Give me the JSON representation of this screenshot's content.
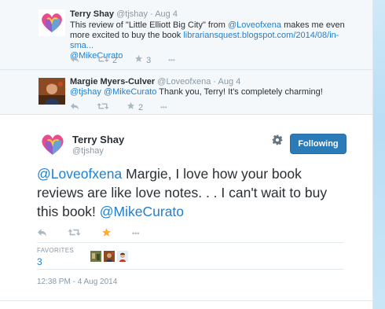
{
  "tweet1": {
    "name": "Terry Shay",
    "handle": "@tjshay",
    "time": "· Aug 4",
    "text_before": "This review of \"Little Elliott Big City\" from ",
    "mention1": "@Loveofxena",
    "text_middle": " makes me even more excited to buy the book ",
    "url": "librariansquest.blogspot.com/2014/08/in-sma...",
    "mention2": "@MikeCurato",
    "retweets": "2",
    "favorites": "3",
    "more": "•••"
  },
  "tweet2": {
    "name": "Margie Myers-Culver",
    "handle": "@Loveofxena",
    "time": "· Aug 4",
    "mention1": "@tjshay",
    "mention2": "@MikeCurato",
    "text": " Thank you, Terry!  It's completely charming!",
    "favorites": "2",
    "more": "•••"
  },
  "main": {
    "name": "Terry Shay",
    "handle": "@tjshay",
    "follow_label": "Following",
    "mention1": "@Loveofxena",
    "text": " Margie, I love how your book reviews are like love notes. . . I can't wait to buy this book! ",
    "mention2": "@MikeCurato",
    "more": "•••",
    "favorites_label": "FAVORITES",
    "favorites_count": "3",
    "timestamp": "12:38 PM - 4 Aug 2014"
  },
  "icons": {
    "reply": "reply-icon",
    "retweet": "retweet-icon",
    "favorite": "star-icon",
    "more": "more-icon",
    "settings": "gear-icon"
  },
  "colors": {
    "link": "#1f7fd1",
    "follow_button": "#2b7bb9",
    "star_active": "#ffac33"
  }
}
